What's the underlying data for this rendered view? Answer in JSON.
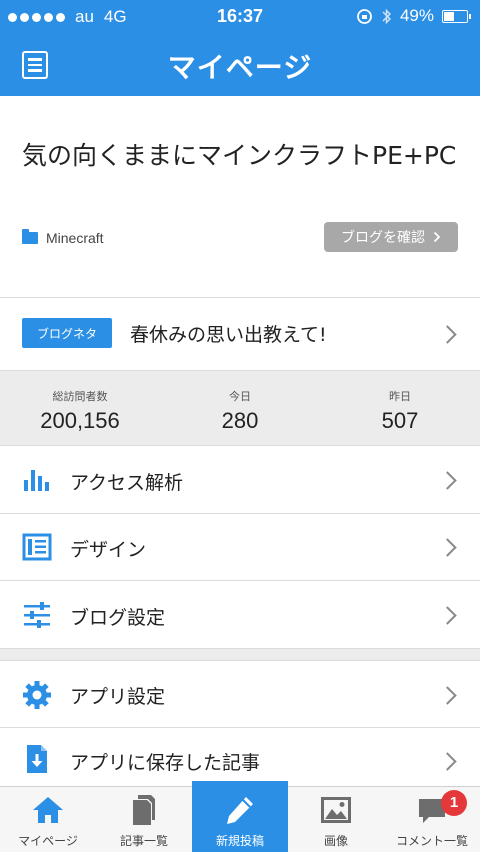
{
  "status": {
    "carrier": "au",
    "network": "4G",
    "time": "16:37",
    "battery": "49%",
    "battery_level": 0.49
  },
  "nav": {
    "title": "マイページ",
    "menu_icon": "menu-list-icon"
  },
  "blog": {
    "title": "気の向くままにマインクラフトPE+PC",
    "category": "Minecraft",
    "check_label": "ブログを確認"
  },
  "neta": {
    "badge": "ブログネタ",
    "text": "春休みの思い出教えて!"
  },
  "stats": [
    {
      "label": "総訪問者数",
      "value": "200,156"
    },
    {
      "label": "今日",
      "value": "280"
    },
    {
      "label": "昨日",
      "value": "507"
    }
  ],
  "menu": [
    {
      "label": "アクセス解析",
      "icon": "bar-chart-icon"
    },
    {
      "label": "デザイン",
      "icon": "layout-icon"
    },
    {
      "label": "ブログ設定",
      "icon": "sliders-icon"
    },
    {
      "label": "アプリ設定",
      "icon": "gear-icon"
    },
    {
      "label": "アプリに保存した記事",
      "icon": "download-file-icon"
    }
  ],
  "tabs": [
    {
      "label": "マイページ",
      "icon": "home-icon"
    },
    {
      "label": "記事一覧",
      "icon": "documents-icon"
    },
    {
      "label": "新規投稿",
      "icon": "pencil-icon"
    },
    {
      "label": "画像",
      "icon": "image-icon"
    },
    {
      "label": "コメント一覧",
      "icon": "comment-icon"
    }
  ],
  "comment_badge": "1",
  "colors": {
    "accent": "#2b8fe6",
    "badge": "#e4383a",
    "band": "#ececec"
  }
}
